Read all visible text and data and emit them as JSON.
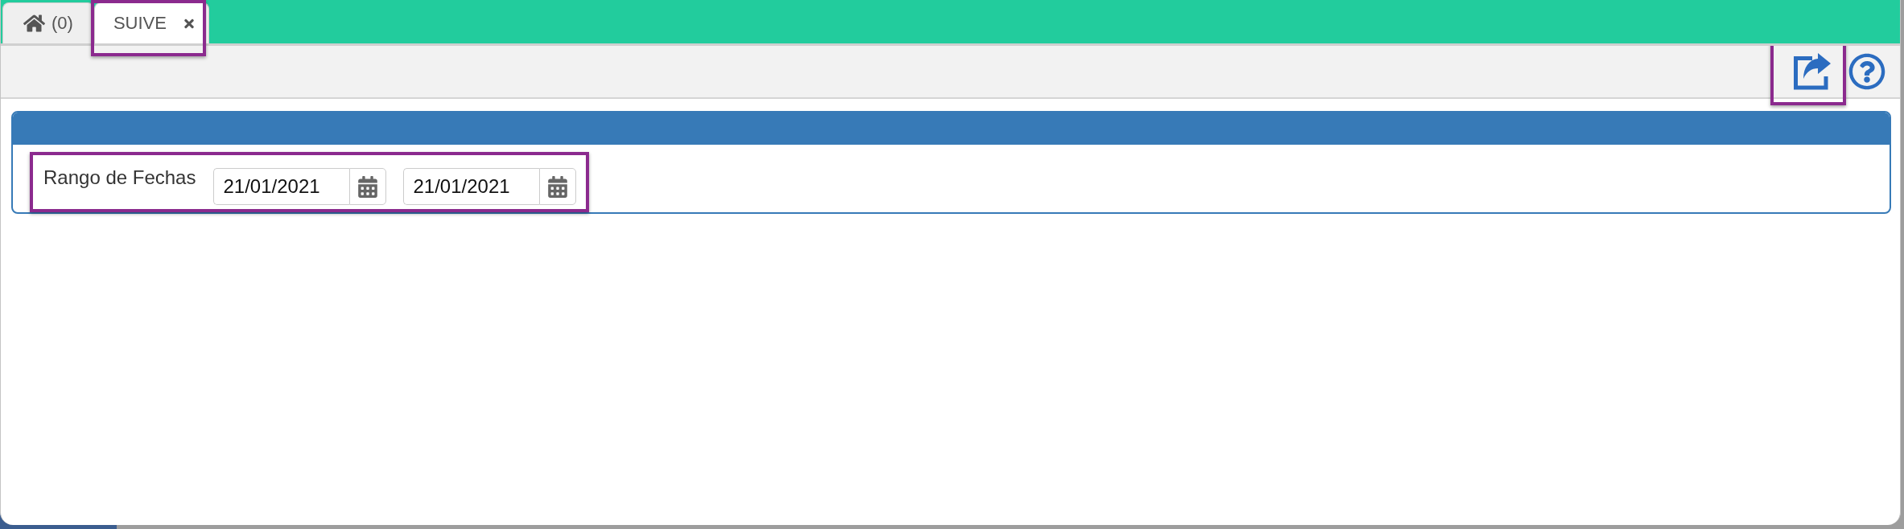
{
  "tabs": [
    {
      "kind": "home",
      "label": "(0)",
      "selected": false,
      "closable": false,
      "highlighted": false
    },
    {
      "kind": "page",
      "label": "SUIVE",
      "selected": true,
      "closable": true,
      "highlighted": true
    }
  ],
  "toolbar": {
    "buttons": [
      {
        "kind": "export",
        "highlighted": true
      },
      {
        "kind": "help",
        "highlighted": false
      }
    ]
  },
  "filter_panel": {
    "date_range": {
      "label": "Rango de Fechas",
      "highlighted": true,
      "fields": [
        {
          "value": "21/01/2021"
        },
        {
          "value": "21/01/2021"
        }
      ]
    }
  }
}
